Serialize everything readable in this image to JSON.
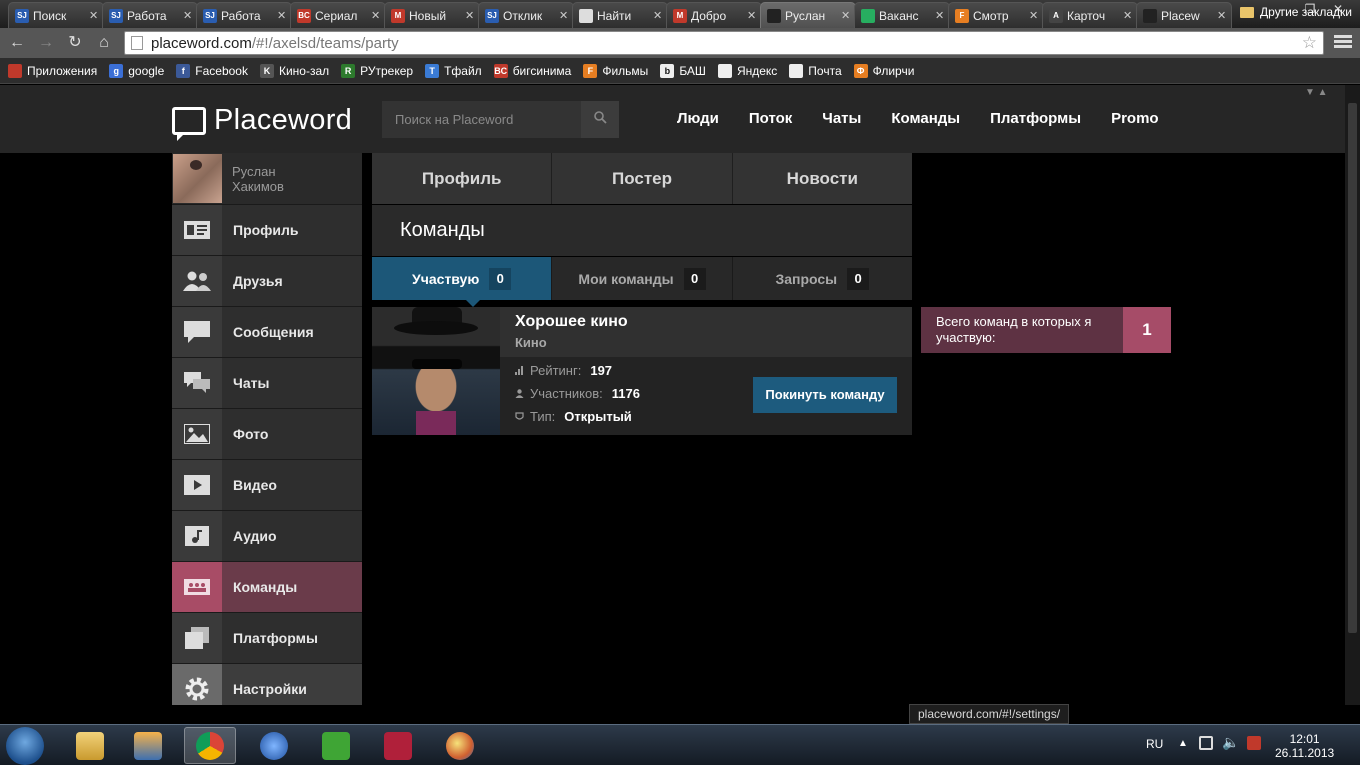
{
  "browser": {
    "tabs": [
      {
        "label": "Поиск",
        "icon_color": "#2a5db0",
        "icon": "SJ"
      },
      {
        "label": "Работа",
        "icon_color": "#2a5db0",
        "icon": "SJ"
      },
      {
        "label": "Работа",
        "icon_color": "#2a5db0",
        "icon": "SJ"
      },
      {
        "label": "Сериал",
        "icon_color": "#c0392b",
        "icon": "BC"
      },
      {
        "label": "Новый",
        "icon_color": "#c0392b",
        "icon": "M"
      },
      {
        "label": "Отклик",
        "icon_color": "#2a5db0",
        "icon": "SJ"
      },
      {
        "label": "Найти",
        "icon_color": "#dddddd",
        "icon": ""
      },
      {
        "label": "Добро",
        "icon_color": "#c0392b",
        "icon": "M"
      },
      {
        "label": "Руслан",
        "icon_color": "#222222",
        "icon": "",
        "active": true
      },
      {
        "label": "Ваканс",
        "icon_color": "#27ae60",
        "icon": ""
      },
      {
        "label": "Смотр",
        "icon_color": "#e67e22",
        "icon": "F"
      },
      {
        "label": "Карточ",
        "icon_color": "#444444",
        "icon": "A"
      },
      {
        "label": "Placew",
        "icon_color": "#222222",
        "icon": ""
      }
    ],
    "url_host": "placeword.com",
    "url_rest": "/#!/axelsd/teams/party",
    "bookmarks": [
      {
        "label": "Приложения",
        "icon_color": "#c0392b",
        "icon": "apps-icon"
      },
      {
        "label": "google",
        "icon_color": "#3b6fd6",
        "icon": "g"
      },
      {
        "label": "Facebook",
        "icon_color": "#3b5998",
        "icon": "f"
      },
      {
        "label": "Кино-зал",
        "icon_color": "#555555",
        "icon": "K"
      },
      {
        "label": "РУтрекер",
        "icon_color": "#2d7a2d",
        "icon": "R"
      },
      {
        "label": "Тфайл",
        "icon_color": "#3a7bd5",
        "icon": "T"
      },
      {
        "label": "бигсинима",
        "icon_color": "#c0392b",
        "icon": "BC"
      },
      {
        "label": "Фильмы",
        "icon_color": "#e67e22",
        "icon": "F"
      },
      {
        "label": "БАШ",
        "icon_color": "#eeeeee",
        "icon": "b"
      },
      {
        "label": "Яндекс",
        "icon_color": "#eeeeee",
        "icon": ""
      },
      {
        "label": "Почта",
        "icon_color": "#eeeeee",
        "icon": ""
      },
      {
        "label": "Флирчи",
        "icon_color": "#e67e22",
        "icon": "Ф"
      }
    ],
    "other_bookmarks": "Другие закладки",
    "status_url": "placeword.com/#!/settings/"
  },
  "site": {
    "logo": "Placeword",
    "search_placeholder": "Поиск на Placeword",
    "nav": [
      "Люди",
      "Поток",
      "Чаты",
      "Команды",
      "Платформы",
      "Promo"
    ]
  },
  "sidebar": {
    "user_first": "Руслан",
    "user_last": "Хакимов",
    "items": [
      {
        "label": "Профиль",
        "icon": "profile-card-icon"
      },
      {
        "label": "Друзья",
        "icon": "friends-icon"
      },
      {
        "label": "Сообщения",
        "icon": "message-icon"
      },
      {
        "label": "Чаты",
        "icon": "chat-icon"
      },
      {
        "label": "Фото",
        "icon": "photo-icon"
      },
      {
        "label": "Видео",
        "icon": "video-icon"
      },
      {
        "label": "Аудио",
        "icon": "audio-icon"
      },
      {
        "label": "Команды",
        "icon": "teams-icon",
        "active": true
      },
      {
        "label": "Платформы",
        "icon": "platforms-icon"
      },
      {
        "label": "Настройки",
        "icon": "gear-icon"
      }
    ]
  },
  "content": {
    "tabs": [
      "Профиль",
      "Постер",
      "Новости"
    ],
    "section_title": "Команды",
    "subtabs": [
      {
        "label": "Участвую",
        "count": "0",
        "active": true
      },
      {
        "label": "Мои команды",
        "count": "0"
      },
      {
        "label": "Запросы",
        "count": "0"
      }
    ],
    "team": {
      "title": "Хорошее кино",
      "category": "Кино",
      "rating_label": "Рейтинг:",
      "rating": "197",
      "members_label": "Участников:",
      "members": "1176",
      "type_label": "Тип:",
      "type": "Открытый",
      "leave_button": "Покинуть команду"
    },
    "summary_text": "Всего команд в которых я участвую:",
    "summary_count": "1"
  },
  "taskbar": {
    "lang": "RU",
    "time": "12:01",
    "date": "26.11.2013"
  },
  "colors": {
    "accent_blue": "#1c5778",
    "accent_pink": "#a84c66"
  }
}
